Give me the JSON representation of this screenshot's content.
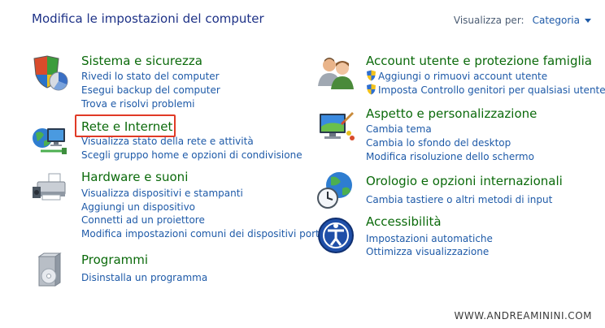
{
  "header": {
    "title": "Modifica le impostazioni del computer",
    "view_by_label": "Visualizza per:",
    "view_by_value": "Categoria"
  },
  "left": [
    {
      "title": "Sistema e sicurezza",
      "links": [
        "Rivedi lo stato del computer",
        "Esegui backup del computer",
        "Trova e risolvi problemi"
      ]
    },
    {
      "title": "Rete e Internet",
      "links": [
        "Visualizza stato della rete e attività",
        "Scegli gruppo home e opzioni di condivisione"
      ]
    },
    {
      "title": "Hardware e suoni",
      "links": [
        "Visualizza dispositivi e stampanti",
        "Aggiungi un dispositivo",
        "Connetti ad un proiettore",
        "Modifica impostazioni comuni dei dispositivi portatili"
      ]
    },
    {
      "title": "Programmi",
      "links": [
        "Disinstalla un programma"
      ]
    }
  ],
  "right": [
    {
      "title": "Account utente e protezione famiglia",
      "links": [
        "Aggiungi o rimuovi account utente",
        "Imposta Controllo genitori per qualsiasi utente"
      ]
    },
    {
      "title": "Aspetto e personalizzazione",
      "links": [
        "Cambia tema",
        "Cambia lo sfondo del desktop",
        "Modifica risoluzione dello schermo"
      ]
    },
    {
      "title": "Orologio e opzioni internazionali",
      "links": [
        "Cambia tastiere o altri metodi di input"
      ]
    },
    {
      "title": "Accessibilità",
      "links": [
        "Impostazioni automatiche",
        "Ottimizza visualizzazione"
      ]
    }
  ],
  "icons": {
    "system_security": "shield-pie-icon",
    "network": "network-globe-icon",
    "hardware": "printer-icon",
    "programs": "software-box-icon",
    "accounts": "users-icon",
    "appearance": "monitor-paint-icon",
    "clock": "globe-clock-icon",
    "accessibility": "accessibility-icon",
    "uac_shield": "uac-shield-icon"
  },
  "watermark": "WWW.ANDREAMININI.COM",
  "colors": {
    "title_green": "#0b6a0b",
    "link_blue": "#1e5aa8",
    "header_blue": "#1e3287",
    "highlight_red": "#e03a26"
  }
}
